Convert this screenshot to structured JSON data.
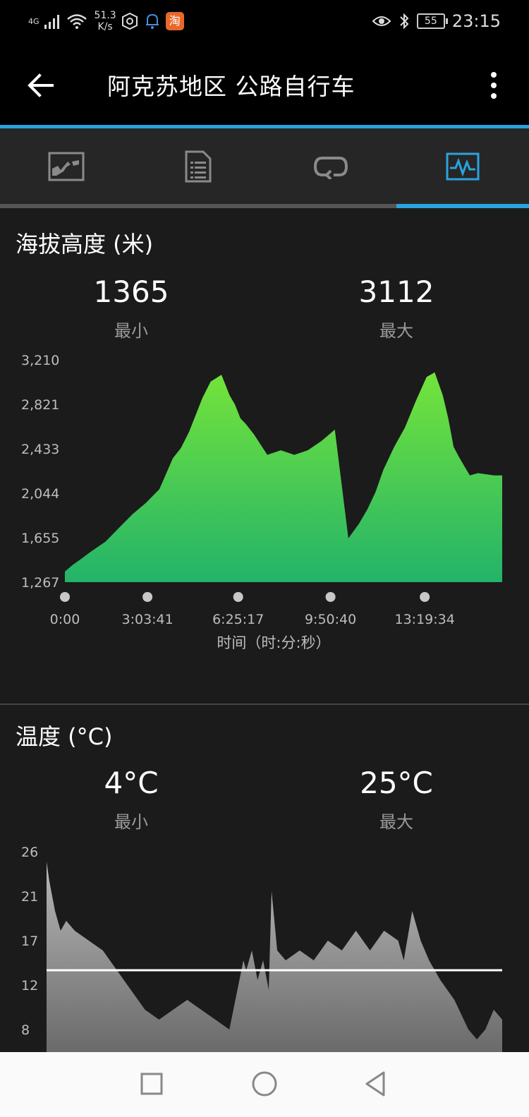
{
  "status_bar": {
    "network": "4G",
    "speed_value": "51.3",
    "speed_unit": "K/s",
    "battery": "55",
    "time": "23:15",
    "taobao_glyph": "淘"
  },
  "app_bar": {
    "title": "阿克苏地区 公路自行车",
    "back_icon": "arrow-left-icon",
    "more_icon": "more-vertical-icon"
  },
  "tabs": [
    {
      "icon": "map-icon",
      "active": false
    },
    {
      "icon": "document-icon",
      "active": false
    },
    {
      "icon": "laps-icon",
      "active": false
    },
    {
      "icon": "chart-icon",
      "active": true
    }
  ],
  "elevation": {
    "title": "海拔高度 (米)",
    "min_value": "1365",
    "min_label": "最小",
    "max_value": "3112",
    "max_label": "最大"
  },
  "temperature": {
    "title": "温度 (°C)",
    "min_value": "4°C",
    "min_label": "最小",
    "max_value": "25°C",
    "max_label": "最大"
  },
  "chart_data": [
    {
      "type": "area",
      "name": "elevation",
      "y_ticks": [
        "3,210",
        "2,821",
        "2,433",
        "2,044",
        "1,655",
        "1,267"
      ],
      "ylim": [
        1267,
        3210
      ],
      "x_ticks": [
        "0:00",
        "3:03:41",
        "6:25:17",
        "9:50:40",
        "13:19:34"
      ],
      "x_tick_positions": [
        0,
        3.06,
        6.42,
        9.84,
        13.33
      ],
      "xlim": [
        0,
        16.2
      ],
      "xlabel": "时间（时:分:秒）",
      "x": [
        0,
        0.3,
        0.6,
        1.0,
        1.5,
        2.0,
        2.5,
        3.0,
        3.5,
        4.0,
        4.3,
        4.6,
        4.9,
        5.1,
        5.4,
        5.8,
        6.1,
        6.3,
        6.5,
        6.7,
        7.0,
        7.5,
        8.0,
        8.5,
        9.0,
        9.5,
        10.0,
        10.5,
        10.9,
        11.2,
        11.5,
        11.8,
        12.2,
        12.6,
        13.0,
        13.4,
        13.7,
        14.0,
        14.2,
        14.4,
        14.6,
        14.8,
        15.0,
        15.3,
        15.6,
        15.9,
        16.2
      ],
      "values": [
        1360,
        1420,
        1470,
        1540,
        1620,
        1740,
        1860,
        1960,
        2080,
        2350,
        2440,
        2580,
        2760,
        2880,
        3020,
        3080,
        2900,
        2820,
        2700,
        2650,
        2560,
        2380,
        2420,
        2380,
        2420,
        2500,
        2600,
        1650,
        1780,
        1900,
        2050,
        2250,
        2450,
        2620,
        2850,
        3060,
        3100,
        2900,
        2700,
        2450,
        2360,
        2280,
        2200,
        2220,
        2210,
        2200,
        2200
      ]
    },
    {
      "type": "area",
      "name": "temperature",
      "y_ticks": [
        "26",
        "21",
        "17",
        "12",
        "8"
      ],
      "ylim": [
        8,
        26
      ],
      "avg_value": 14,
      "x": [
        0,
        0.1,
        0.3,
        0.5,
        0.7,
        1.0,
        1.5,
        2.0,
        2.5,
        3.0,
        3.5,
        4.0,
        4.5,
        5.0,
        5.5,
        6.0,
        6.5,
        7.0,
        7.1,
        7.3,
        7.5,
        7.7,
        7.9,
        8.0,
        8.2,
        8.5,
        9.0,
        9.5,
        10.0,
        10.5,
        11.0,
        11.5,
        12.0,
        12.5,
        12.7,
        13.0,
        13.3,
        13.6,
        14.0,
        14.5,
        15.0,
        15.3,
        15.6,
        15.9,
        16.2
      ],
      "values": [
        25,
        23,
        20,
        18,
        19,
        18,
        17,
        16,
        14,
        12,
        10,
        9,
        10,
        11,
        10,
        9,
        8,
        15,
        14,
        16,
        13,
        15,
        12,
        22,
        16,
        15,
        16,
        15,
        17,
        16,
        18,
        16,
        18,
        17,
        15,
        20,
        17,
        15,
        13,
        11,
        8,
        7,
        8,
        10,
        9
      ]
    }
  ],
  "bottom_nav": {
    "recent_icon": "square-icon",
    "home_icon": "circle-icon",
    "back_icon": "triangle-back-icon"
  }
}
